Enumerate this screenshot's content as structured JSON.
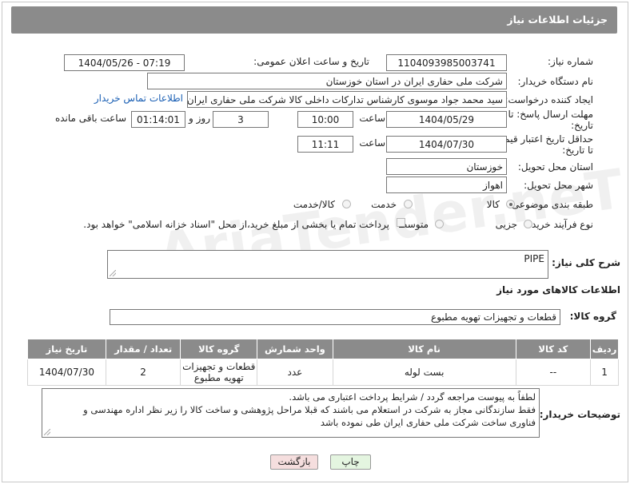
{
  "header": {
    "title": "جزئیات اطلاعات نیاز"
  },
  "watermark": {
    "text": "AriaTender.neT"
  },
  "fields": {
    "need_number": {
      "label": "شماره نیاز:",
      "value": "1104093985003741"
    },
    "announce": {
      "label": "تاریخ و ساعت اعلان عمومی:",
      "value": "1404/05/26 - 07:19"
    },
    "buyer_org": {
      "label": "نام دستگاه خریدار:",
      "value": "شرکت ملی حفاری ایران در استان خوزستان"
    },
    "creator": {
      "label": "ایجاد کننده درخواست:",
      "value": "سید محمد جواد موسوی کارشناس تدارکات داخلی کالا شرکت ملی حفاری ایران",
      "contact_link": "اطلاعات تماس خریدار"
    },
    "deadline": {
      "label_line1": "مهلت ارسال پاسخ: تا",
      "label_line2": "تاریخ:",
      "date": "1404/05/29",
      "time_label": "ساعت",
      "time": "10:00",
      "days": "3",
      "days_label": "روز و",
      "remaining": "01:14:01",
      "remaining_label": "ساعت باقی مانده"
    },
    "price_validity": {
      "label_line1": "حداقل تاریخ اعتبار قیمت:",
      "label_line2": "تا تاریخ:",
      "date": "1404/07/30",
      "time_label": "ساعت",
      "time": "11:11"
    },
    "province": {
      "label": "استان محل تحویل:",
      "value": "خوزستان"
    },
    "city": {
      "label": "شهر محل تحویل:",
      "value": "اهواز"
    },
    "category": {
      "label": "طبقه بندی موضوعی:",
      "options": [
        "کالا",
        "خدمت",
        "کالا/خدمت"
      ],
      "selected": "کالا"
    },
    "process": {
      "label": "نوع فرآیند خرید :",
      "options": [
        "جزیی",
        "متوسط"
      ],
      "payment_note": "پرداخت تمام یا بخشی از مبلغ خرید،از محل \"اسناد خزانه اسلامی\" خواهد بود."
    }
  },
  "summary": {
    "label": "شرح کلی نیاز:",
    "value": "PIPE"
  },
  "goods_section": {
    "title": "اطلاعات کالاهای مورد نیاز",
    "group_label": "گروه کالا:",
    "group_value": "قطعات و تجهیزات تهویه مطبوع"
  },
  "table": {
    "headers": [
      "ردیف",
      "کد کالا",
      "نام کالا",
      "واحد شمارش",
      "گروه کالا",
      "تعداد / مقدار",
      "تاریخ نیاز"
    ],
    "rows": [
      [
        "1",
        "--",
        "بست لوله",
        "عدد",
        "قطعات و تجهیزات تهویه مطبوع",
        "2",
        "1404/07/30"
      ]
    ]
  },
  "buyer_notes": {
    "label": "توضیحات خریدار:",
    "lines": [
      "لطفاً به پیوست مراجعه گردد / شرایط پرداخت اعتباری می باشد.",
      "فقط سازندگانی مجاز به شرکت در استعلام می باشند که قبلا مراحل پژوهشی و ساخت کالا را زیر نظر اداره مهندسی و",
      "فناوری ساخت شرکت ملی حفاری ایران طی نموده باشد"
    ]
  },
  "buttons": {
    "print": "چاپ",
    "back": "بازگشت"
  },
  "colors": {
    "header_bg": "#8b8b8b",
    "link": "#1a5fb4",
    "back_bg": "#f5dede",
    "print_bg": "#e4f5e0"
  }
}
